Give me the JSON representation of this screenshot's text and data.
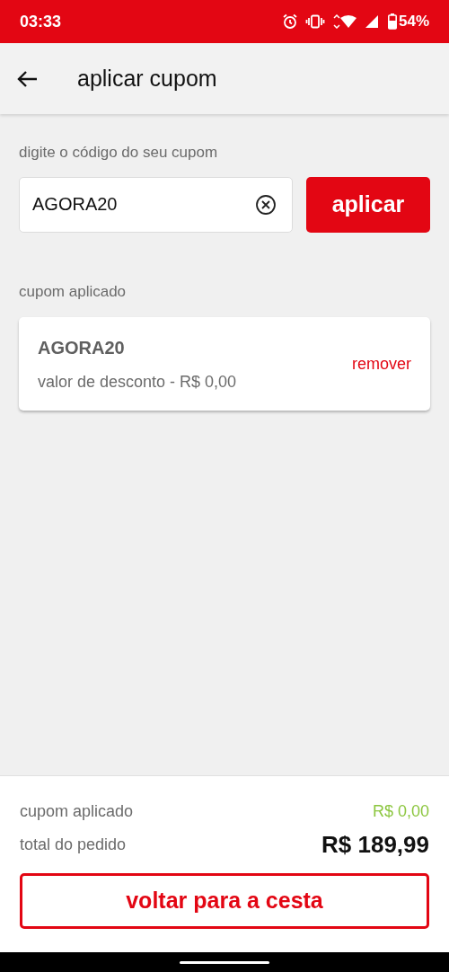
{
  "status_bar": {
    "time": "03:33",
    "battery": "54%"
  },
  "header": {
    "title": "aplicar cupom"
  },
  "coupon_input": {
    "label": "digite o código do seu cupom",
    "value": "AGORA20",
    "button": "aplicar"
  },
  "applied": {
    "label": "cupom aplicado",
    "code": "AGORA20",
    "discount": "valor de desconto - R$ 0,00",
    "action": "remover"
  },
  "summary": {
    "coupon_label": "cupom aplicado",
    "coupon_value": "R$ 0,00",
    "total_label": "total do pedido",
    "total_value": "R$ 189,99",
    "button": "voltar para a cesta"
  }
}
